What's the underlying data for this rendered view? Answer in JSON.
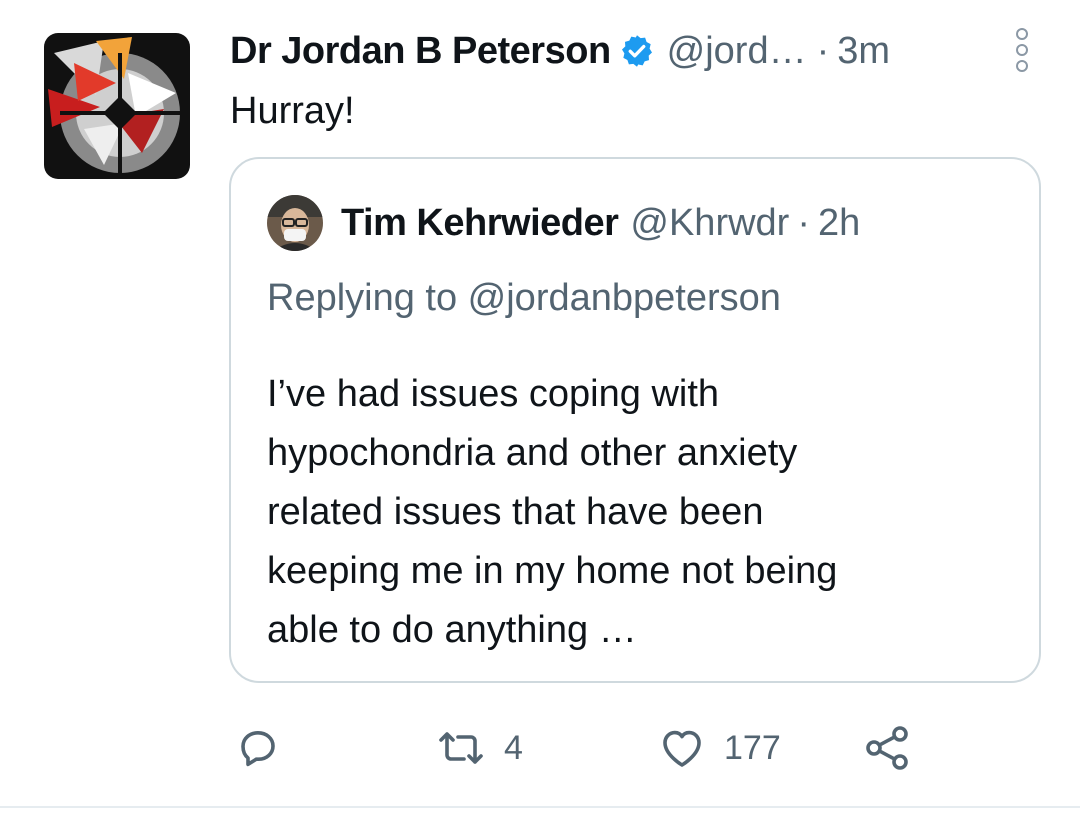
{
  "tweet": {
    "author_name": "Dr Jordan B Peterson",
    "author_handle": "@jord…",
    "separator": "·",
    "time": "3m",
    "text": "Hurray!",
    "icons": {
      "avatar": "abstract-compass-logo-avatar",
      "verified": "verified-badge-icon",
      "more": "more-options-icon"
    },
    "verified_color": "#1d9bf0"
  },
  "quoted_tweet": {
    "author_name": "Tim Kehrwieder",
    "author_handle": "@Khrwdr",
    "separator": "·",
    "time": "2h",
    "replying_to": "Replying to @jordanbpeterson",
    "body_lines": [
      "I’ve had issues coping with",
      "hypochondria and other anxiety",
      "related issues that have been",
      "keeping me in my home not being",
      "able to do anything …"
    ],
    "icons": {
      "avatar": "user-avatar-photo"
    }
  },
  "actions": {
    "reply": {
      "icon": "reply-icon",
      "count": ""
    },
    "retweet": {
      "icon": "retweet-icon",
      "count": "4"
    },
    "like": {
      "icon": "heart-icon",
      "count": "177"
    },
    "share": {
      "icon": "share-icon"
    }
  },
  "colors": {
    "text_primary": "#0f1419",
    "text_secondary": "#536471",
    "border": "#cfd9de",
    "verified": "#1d9bf0"
  }
}
